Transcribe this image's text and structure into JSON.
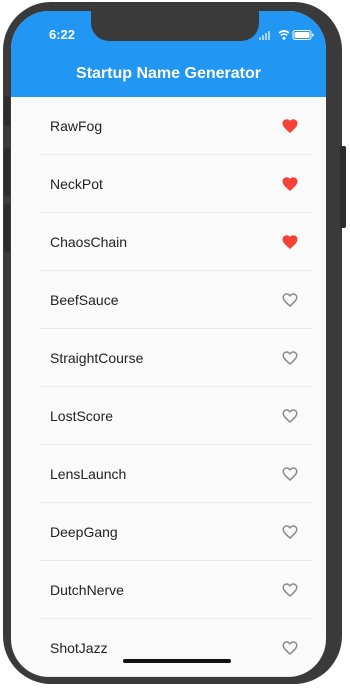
{
  "status_bar": {
    "time": "6:22"
  },
  "app_bar": {
    "title": "Startup Name Generator",
    "color": "#2196f3"
  },
  "list": {
    "items": [
      {
        "name": "RawFog",
        "saved": true
      },
      {
        "name": "NeckPot",
        "saved": true
      },
      {
        "name": "ChaosChain",
        "saved": true
      },
      {
        "name": "BeefSauce",
        "saved": false
      },
      {
        "name": "StraightCourse",
        "saved": false
      },
      {
        "name": "LostScore",
        "saved": false
      },
      {
        "name": "LensLaunch",
        "saved": false
      },
      {
        "name": "DeepGang",
        "saved": false
      },
      {
        "name": "DutchNerve",
        "saved": false
      },
      {
        "name": "ShotJazz",
        "saved": false
      }
    ]
  },
  "icons": {
    "saved": "favorite-icon",
    "unsaved": "favorite-border-icon",
    "saved_color": "#f44336",
    "unsaved_color": "#8a8a8a"
  }
}
